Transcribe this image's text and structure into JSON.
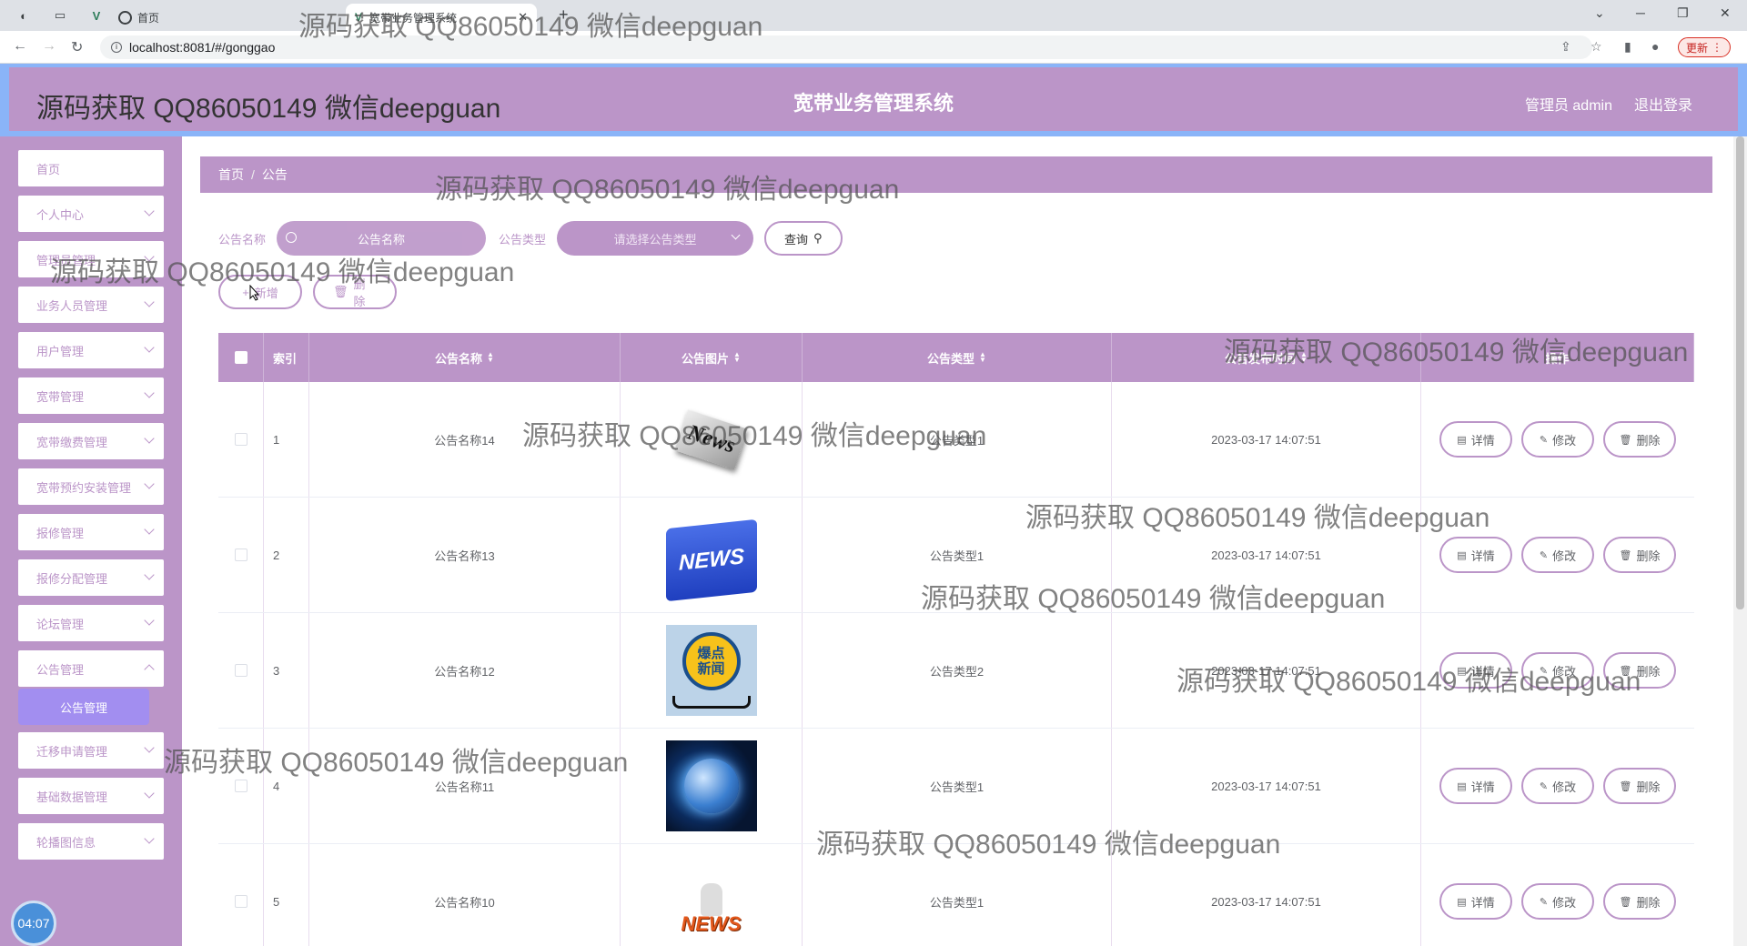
{
  "browser": {
    "tab_title": "首页",
    "tab2_title": "宽带业务管理系统",
    "url": "localhost:8081/#/gonggao",
    "update_label": "更新"
  },
  "header": {
    "brand": "源码获取 QQ86050149 微信deepguan",
    "title": "宽带业务管理系统",
    "user": "管理员 admin",
    "logout": "退出登录"
  },
  "sidebar": {
    "items": [
      {
        "label": "首页"
      },
      {
        "label": "个人中心"
      },
      {
        "label": "管理员管理"
      },
      {
        "label": "业务人员管理"
      },
      {
        "label": "用户管理"
      },
      {
        "label": "宽带管理"
      },
      {
        "label": "宽带缴费管理"
      },
      {
        "label": "宽带预约安装管理"
      },
      {
        "label": "报修管理"
      },
      {
        "label": "报修分配管理"
      },
      {
        "label": "论坛管理"
      },
      {
        "label": "公告管理"
      },
      {
        "label": "迁移申请管理"
      },
      {
        "label": "基础数据管理"
      },
      {
        "label": "轮播图信息"
      }
    ],
    "active_sub": "公告管理",
    "clock": "04:07"
  },
  "breadcrumb": {
    "home": "首页",
    "current": "公告"
  },
  "search": {
    "name_label": "公告名称",
    "name_placeholder": "公告名称",
    "type_label": "公告类型",
    "type_placeholder": "请选择公告类型",
    "query_label": "查询"
  },
  "actions": {
    "add": "新增",
    "delete": "删除"
  },
  "table": {
    "headers": {
      "index": "索引",
      "name": "公告名称",
      "pic": "公告图片",
      "type": "公告类型",
      "time": "公告发布时间",
      "op": "操作"
    },
    "rows": [
      {
        "index": "1",
        "name": "公告名称14",
        "type": "公告类型1",
        "time": "2023-03-17 14:07:51",
        "pic": "news-gray"
      },
      {
        "index": "2",
        "name": "公告名称13",
        "type": "公告类型1",
        "time": "2023-03-17 14:07:51",
        "pic": "news-blue"
      },
      {
        "index": "3",
        "name": "公告名称12",
        "type": "公告类型2",
        "time": "2023-03-17 14:07:51",
        "pic": "news-phone"
      },
      {
        "index": "4",
        "name": "公告名称11",
        "type": "公告类型1",
        "time": "2023-03-17 14:07:51",
        "pic": "globe"
      },
      {
        "index": "5",
        "name": "公告名称10",
        "type": "公告类型1",
        "time": "2023-03-17 14:07:51",
        "pic": "news-3d"
      }
    ],
    "op_labels": {
      "detail": "详情",
      "edit": "修改",
      "delete": "删除"
    }
  },
  "pic_texts": {
    "news_gray": "News",
    "news_blue": "NEWS",
    "phone_line1": "爆点",
    "phone_line2": "新闻",
    "news_3d": "NEWS"
  },
  "watermark": "源码获取 QQ86050149 微信deepguan",
  "colors": {
    "primary": "#bb95c8",
    "sub_active": "#a28ef0",
    "header_outer": "#8ab4f8"
  }
}
